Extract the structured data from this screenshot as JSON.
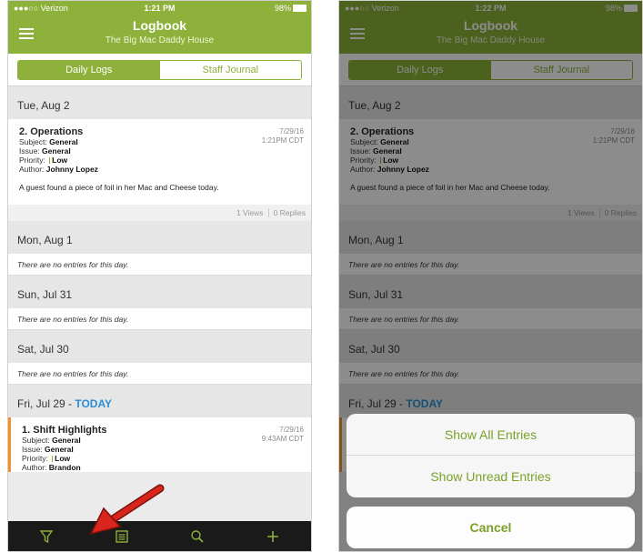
{
  "status": {
    "carrier": "●●●○○ Verizon",
    "time_left": "1:21 PM",
    "time_right": "1:22 PM",
    "battery": "98%"
  },
  "nav": {
    "title": "Logbook",
    "subtitle": "The Big Mac Daddy House"
  },
  "tabs": {
    "daily_logs": "Daily Logs",
    "staff_journal": "Staff Journal"
  },
  "days": [
    {
      "label": "Tue, Aug 2"
    },
    {
      "label": "Mon, Aug 1"
    },
    {
      "label": "Sun, Jul 31"
    },
    {
      "label": "Sat, Jul 30"
    },
    {
      "label": "Fri, Jul 29 - ",
      "today": "TODAY"
    }
  ],
  "empty_text": "There are no entries for this day.",
  "entries": [
    {
      "title": "2. Operations",
      "date": "7/29/16",
      "time": "1:21PM CDT",
      "subject_label": "Subject: ",
      "subject": "General",
      "issue_label": "Issue: ",
      "issue": "General",
      "priority_label": "Priority: ",
      "priority": "Low",
      "author_label": "Author: ",
      "author": "Johnny Lopez",
      "body": "A guest found a piece of foil in her Mac and Cheese today.",
      "views": "1 Views",
      "replies": "0 Replies"
    },
    {
      "title": "1. Shift Highlights",
      "date": "7/29/16",
      "time": "9:43AM CDT",
      "subject_label": "Subject: ",
      "subject": "General",
      "issue_label": "Issue: ",
      "issue": "General",
      "priority_label": "Priority: ",
      "priority": "Low",
      "author_label": "Author: ",
      "author": "Brandon"
    }
  ],
  "action_sheet": {
    "show_all": "Show All Entries",
    "show_unread": "Show Unread Entries",
    "cancel": "Cancel"
  },
  "icons": {
    "filter": "filter-icon",
    "journal": "journal-icon",
    "search": "search-icon",
    "add": "add-icon",
    "menu": "menu-icon"
  },
  "colors": {
    "brand_green": "#8db13a",
    "today_blue": "#2b8fd4",
    "flag_orange": "#f0902e",
    "arrow_red": "#d9251c",
    "tabbar": "#1a1a1a"
  }
}
